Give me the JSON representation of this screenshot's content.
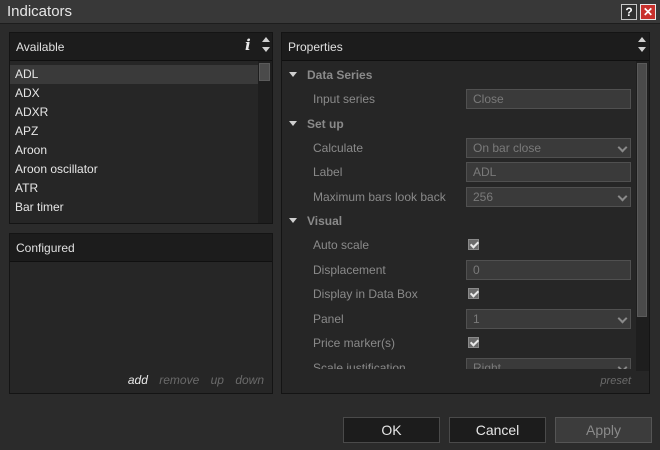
{
  "window": {
    "title": "Indicators",
    "help_label": "?",
    "close_label": "✕"
  },
  "available": {
    "title": "Available",
    "info_label": "i",
    "items": [
      "ADL",
      "ADX",
      "ADXR",
      "APZ",
      "Aroon",
      "Aroon oscillator",
      "ATR",
      "Bar timer"
    ],
    "selected_index": 0
  },
  "configured": {
    "title": "Configured",
    "actions": {
      "add": "add",
      "remove": "remove",
      "up": "up",
      "down": "down"
    }
  },
  "properties": {
    "title": "Properties",
    "preset_label": "preset",
    "categories": {
      "data_series": "Data Series",
      "setup": "Set up",
      "visual": "Visual"
    },
    "rows": {
      "input_series": {
        "label": "Input series",
        "value": "Close"
      },
      "calculate": {
        "label": "Calculate",
        "value": "On bar close"
      },
      "label": {
        "label": "Label",
        "value": "ADL"
      },
      "max_bars": {
        "label": "Maximum bars look back",
        "value": "256"
      },
      "auto_scale": {
        "label": "Auto scale",
        "checked": true
      },
      "displacement": {
        "label": "Displacement",
        "value": "0"
      },
      "display_data_box": {
        "label": "Display in Data Box",
        "checked": true
      },
      "panel": {
        "label": "Panel",
        "value": "1"
      },
      "price_markers": {
        "label": "Price marker(s)",
        "checked": true
      },
      "scale_justification": {
        "label": "Scale justification",
        "value": "Right"
      }
    }
  },
  "buttons": {
    "ok": "OK",
    "cancel": "Cancel",
    "apply": "Apply"
  }
}
